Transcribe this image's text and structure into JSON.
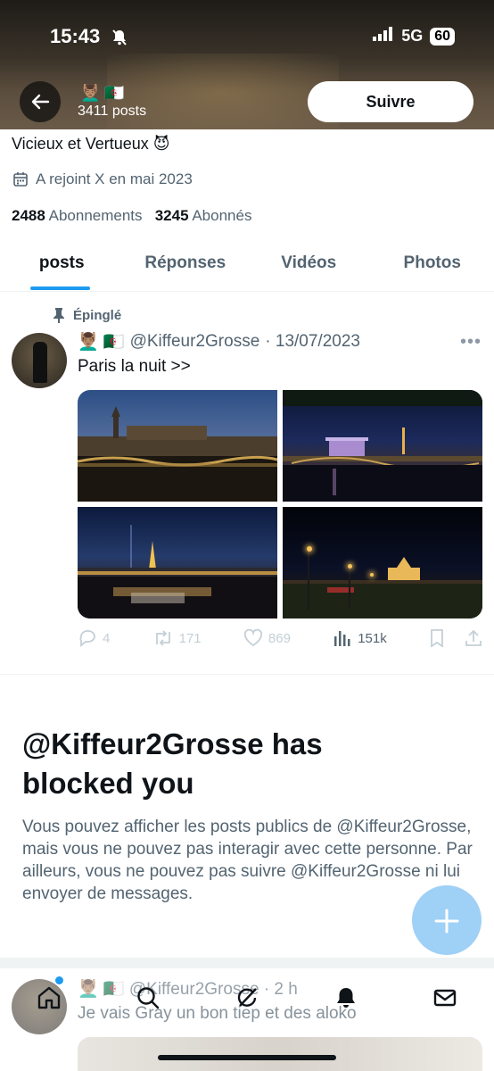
{
  "status_bar": {
    "time": "15:43",
    "network": "5G",
    "battery": "60"
  },
  "header": {
    "name_emoji": "💆🏽‍♂️ 🇩🇿",
    "posts_count": "3411 posts",
    "follow_label": "Suivre"
  },
  "profile": {
    "bio": "Vicieux et Vertueux 😈",
    "joined": "A rejoint X en mai 2023",
    "following_count": "2488",
    "following_label": "Abonnements",
    "followers_count": "3245",
    "followers_label": "Abonnés"
  },
  "tabs": [
    {
      "label": "posts"
    },
    {
      "label": "Réponses"
    },
    {
      "label": "Vidéos"
    },
    {
      "label": "Photos"
    }
  ],
  "pinned_post": {
    "pinned_label": "Épinglé",
    "emoji": "💆🏽‍♂️ 🇩🇿",
    "handle": "@Kiffeur2Grosse",
    "date": "· 13/07/2023",
    "text": "Paris la nuit >>",
    "replies": "4",
    "reposts": "171",
    "likes": "869",
    "views": "151k"
  },
  "blocked": {
    "title": "@Kiffeur2Grosse has blocked you",
    "text": "Vous pouvez afficher les posts publics de @Kiffeur2Grosse, mais vous ne pouvez pas interagir avec cette personne. Par ailleurs, vous ne pouvez pas suivre @Kiffeur2Grosse ni lui envoyer de messages."
  },
  "second_post": {
    "emoji": "💆🏽‍♂️ 🇩🇿",
    "handle": "@Kiffeur2Grosse",
    "time": "· 2 h",
    "text": "Je vais Gray un bon tiep et des aloko"
  },
  "colors": {
    "accent": "#1d9bf0",
    "fab": "#9fd0f6",
    "secondary_text": "#536471"
  },
  "icons": {
    "back": "arrow-left-icon",
    "calendar": "calendar-icon",
    "pin": "pin-icon",
    "more": "more-icon",
    "reply": "reply-icon",
    "repost": "repost-icon",
    "like": "heart-icon",
    "views": "views-icon",
    "bookmark": "bookmark-icon",
    "share": "share-icon",
    "compose": "plus-icon",
    "nav": [
      "home-icon",
      "search-icon",
      "grok-icon",
      "notifications-icon",
      "messages-icon"
    ]
  }
}
